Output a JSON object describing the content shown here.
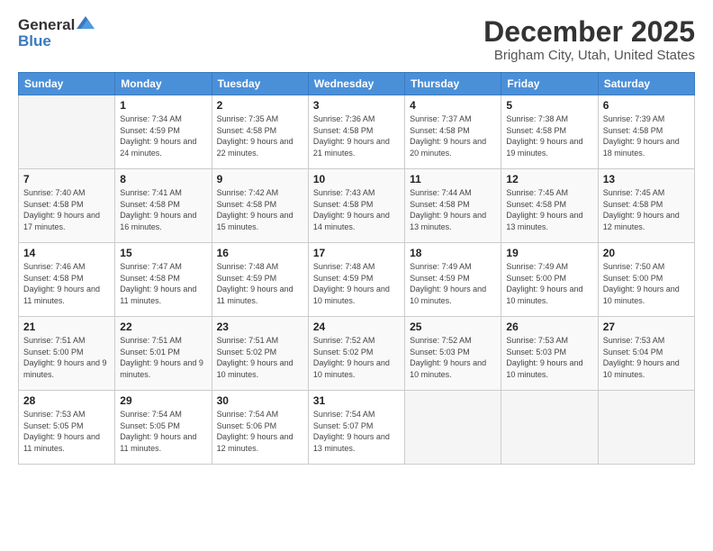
{
  "logo": {
    "line1": "General",
    "line2": "Blue"
  },
  "header": {
    "month": "December 2025",
    "location": "Brigham City, Utah, United States"
  },
  "weekdays": [
    "Sunday",
    "Monday",
    "Tuesday",
    "Wednesday",
    "Thursday",
    "Friday",
    "Saturday"
  ],
  "weeks": [
    [
      {
        "day": "",
        "sunrise": "",
        "sunset": "",
        "daylight": ""
      },
      {
        "day": "1",
        "sunrise": "Sunrise: 7:34 AM",
        "sunset": "Sunset: 4:59 PM",
        "daylight": "Daylight: 9 hours and 24 minutes."
      },
      {
        "day": "2",
        "sunrise": "Sunrise: 7:35 AM",
        "sunset": "Sunset: 4:58 PM",
        "daylight": "Daylight: 9 hours and 22 minutes."
      },
      {
        "day": "3",
        "sunrise": "Sunrise: 7:36 AM",
        "sunset": "Sunset: 4:58 PM",
        "daylight": "Daylight: 9 hours and 21 minutes."
      },
      {
        "day": "4",
        "sunrise": "Sunrise: 7:37 AM",
        "sunset": "Sunset: 4:58 PM",
        "daylight": "Daylight: 9 hours and 20 minutes."
      },
      {
        "day": "5",
        "sunrise": "Sunrise: 7:38 AM",
        "sunset": "Sunset: 4:58 PM",
        "daylight": "Daylight: 9 hours and 19 minutes."
      },
      {
        "day": "6",
        "sunrise": "Sunrise: 7:39 AM",
        "sunset": "Sunset: 4:58 PM",
        "daylight": "Daylight: 9 hours and 18 minutes."
      }
    ],
    [
      {
        "day": "7",
        "sunrise": "Sunrise: 7:40 AM",
        "sunset": "Sunset: 4:58 PM",
        "daylight": "Daylight: 9 hours and 17 minutes."
      },
      {
        "day": "8",
        "sunrise": "Sunrise: 7:41 AM",
        "sunset": "Sunset: 4:58 PM",
        "daylight": "Daylight: 9 hours and 16 minutes."
      },
      {
        "day": "9",
        "sunrise": "Sunrise: 7:42 AM",
        "sunset": "Sunset: 4:58 PM",
        "daylight": "Daylight: 9 hours and 15 minutes."
      },
      {
        "day": "10",
        "sunrise": "Sunrise: 7:43 AM",
        "sunset": "Sunset: 4:58 PM",
        "daylight": "Daylight: 9 hours and 14 minutes."
      },
      {
        "day": "11",
        "sunrise": "Sunrise: 7:44 AM",
        "sunset": "Sunset: 4:58 PM",
        "daylight": "Daylight: 9 hours and 13 minutes."
      },
      {
        "day": "12",
        "sunrise": "Sunrise: 7:45 AM",
        "sunset": "Sunset: 4:58 PM",
        "daylight": "Daylight: 9 hours and 13 minutes."
      },
      {
        "day": "13",
        "sunrise": "Sunrise: 7:45 AM",
        "sunset": "Sunset: 4:58 PM",
        "daylight": "Daylight: 9 hours and 12 minutes."
      }
    ],
    [
      {
        "day": "14",
        "sunrise": "Sunrise: 7:46 AM",
        "sunset": "Sunset: 4:58 PM",
        "daylight": "Daylight: 9 hours and 11 minutes."
      },
      {
        "day": "15",
        "sunrise": "Sunrise: 7:47 AM",
        "sunset": "Sunset: 4:58 PM",
        "daylight": "Daylight: 9 hours and 11 minutes."
      },
      {
        "day": "16",
        "sunrise": "Sunrise: 7:48 AM",
        "sunset": "Sunset: 4:59 PM",
        "daylight": "Daylight: 9 hours and 11 minutes."
      },
      {
        "day": "17",
        "sunrise": "Sunrise: 7:48 AM",
        "sunset": "Sunset: 4:59 PM",
        "daylight": "Daylight: 9 hours and 10 minutes."
      },
      {
        "day": "18",
        "sunrise": "Sunrise: 7:49 AM",
        "sunset": "Sunset: 4:59 PM",
        "daylight": "Daylight: 9 hours and 10 minutes."
      },
      {
        "day": "19",
        "sunrise": "Sunrise: 7:49 AM",
        "sunset": "Sunset: 5:00 PM",
        "daylight": "Daylight: 9 hours and 10 minutes."
      },
      {
        "day": "20",
        "sunrise": "Sunrise: 7:50 AM",
        "sunset": "Sunset: 5:00 PM",
        "daylight": "Daylight: 9 hours and 10 minutes."
      }
    ],
    [
      {
        "day": "21",
        "sunrise": "Sunrise: 7:51 AM",
        "sunset": "Sunset: 5:00 PM",
        "daylight": "Daylight: 9 hours and 9 minutes."
      },
      {
        "day": "22",
        "sunrise": "Sunrise: 7:51 AM",
        "sunset": "Sunset: 5:01 PM",
        "daylight": "Daylight: 9 hours and 9 minutes."
      },
      {
        "day": "23",
        "sunrise": "Sunrise: 7:51 AM",
        "sunset": "Sunset: 5:02 PM",
        "daylight": "Daylight: 9 hours and 10 minutes."
      },
      {
        "day": "24",
        "sunrise": "Sunrise: 7:52 AM",
        "sunset": "Sunset: 5:02 PM",
        "daylight": "Daylight: 9 hours and 10 minutes."
      },
      {
        "day": "25",
        "sunrise": "Sunrise: 7:52 AM",
        "sunset": "Sunset: 5:03 PM",
        "daylight": "Daylight: 9 hours and 10 minutes."
      },
      {
        "day": "26",
        "sunrise": "Sunrise: 7:53 AM",
        "sunset": "Sunset: 5:03 PM",
        "daylight": "Daylight: 9 hours and 10 minutes."
      },
      {
        "day": "27",
        "sunrise": "Sunrise: 7:53 AM",
        "sunset": "Sunset: 5:04 PM",
        "daylight": "Daylight: 9 hours and 10 minutes."
      }
    ],
    [
      {
        "day": "28",
        "sunrise": "Sunrise: 7:53 AM",
        "sunset": "Sunset: 5:05 PM",
        "daylight": "Daylight: 9 hours and 11 minutes."
      },
      {
        "day": "29",
        "sunrise": "Sunrise: 7:54 AM",
        "sunset": "Sunset: 5:05 PM",
        "daylight": "Daylight: 9 hours and 11 minutes."
      },
      {
        "day": "30",
        "sunrise": "Sunrise: 7:54 AM",
        "sunset": "Sunset: 5:06 PM",
        "daylight": "Daylight: 9 hours and 12 minutes."
      },
      {
        "day": "31",
        "sunrise": "Sunrise: 7:54 AM",
        "sunset": "Sunset: 5:07 PM",
        "daylight": "Daylight: 9 hours and 13 minutes."
      },
      {
        "day": "",
        "sunrise": "",
        "sunset": "",
        "daylight": ""
      },
      {
        "day": "",
        "sunrise": "",
        "sunset": "",
        "daylight": ""
      },
      {
        "day": "",
        "sunrise": "",
        "sunset": "",
        "daylight": ""
      }
    ]
  ]
}
